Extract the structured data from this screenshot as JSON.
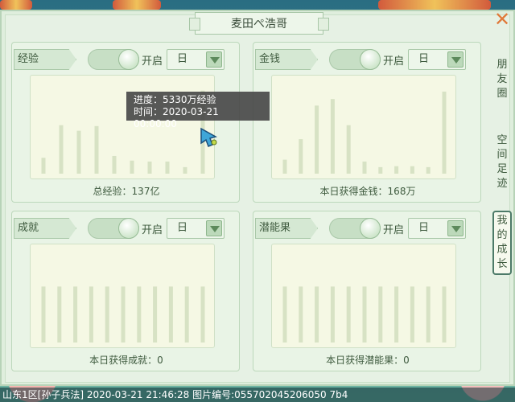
{
  "window": {
    "title": "麦田ぺ浩哥",
    "close_glyph": "✕"
  },
  "side_tabs": [
    {
      "label": "朋\n友\n圈",
      "active": false
    },
    {
      "label": "空\n间\n足\n迹",
      "active": false
    },
    {
      "label": "我\n的\n成\n长",
      "active": true
    }
  ],
  "panels": [
    {
      "tag": "经验",
      "toggle_label": "开启",
      "select_value": "日",
      "caption": "总经验：137亿"
    },
    {
      "tag": "金钱",
      "toggle_label": "开启",
      "select_value": "日",
      "caption": "本日获得金钱：168万"
    },
    {
      "tag": "成就",
      "toggle_label": "开启",
      "select_value": "日",
      "caption": "本日获得成就：0"
    },
    {
      "tag": "潜能果",
      "toggle_label": "开启",
      "select_value": "日",
      "caption": "本日获得潜能果：0"
    }
  ],
  "tooltip": {
    "line1": "进度：5330万经验",
    "line2": "时间：2020-03-21 00:00:00"
  },
  "status_bar": "山东1区[孙子兵法] 2020-03-21 21:46:28 图片编号:055702045206050 7b4",
  "colors": {
    "bar": "#d7e2c4",
    "accent_close": "#e07a3a",
    "panel_bg": "#e9f4e6"
  },
  "chart_data": [
    {
      "type": "bar",
      "series": [
        {
          "values": [
            0.17,
            0.52,
            0.46,
            0.51,
            0.19,
            0.14,
            0.13,
            0.13,
            0.07,
            0.89
          ]
        }
      ],
      "ylim": [
        0,
        1
      ],
      "grid": false
    },
    {
      "type": "bar",
      "series": [
        {
          "values": [
            0.15,
            0.37,
            0.73,
            0.8,
            0.52,
            0.13,
            0.07,
            0.08,
            0.08,
            0.07,
            0.88
          ]
        }
      ],
      "ylim": [
        0,
        1
      ],
      "grid": false
    },
    {
      "type": "bar",
      "series": [
        {
          "values": [
            0.6,
            0.6,
            0.6,
            0.6,
            0.6,
            0.6,
            0.6,
            0.6,
            0.6,
            0.6,
            0.6
          ]
        }
      ],
      "ylim": [
        0,
        1
      ],
      "grid": false
    },
    {
      "type": "bar",
      "series": [
        {
          "values": [
            0.6,
            0.6,
            0.6,
            0.6,
            0.6,
            0.6,
            0.6,
            0.6,
            0.6,
            0.6,
            0.6
          ]
        }
      ],
      "ylim": [
        0,
        1
      ],
      "grid": false
    }
  ]
}
